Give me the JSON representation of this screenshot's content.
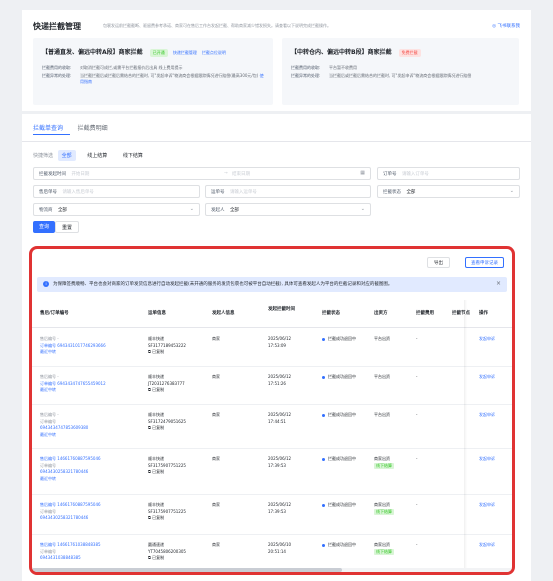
{
  "header": {
    "title": "快递拦截管理",
    "description": "包裹发运前拦截截断、驱留费参考承诺、商家可在售后工作台发起拦截、帮助商家减少错发损失。请查看以下说明完成拦截操作。",
    "help_link": "飞书联系我"
  },
  "rule_boxes": [
    {
      "title": "【普通直发、偏远中转A段】商家拦截",
      "tags": [
        "已开通",
        "快递拦截管理",
        "拦截点位说明"
      ],
      "fee_label": "拦截费用的收取:",
      "fee_text": "对取消拦截可成拦,或需平台拦截报价后出具 线上费用提示",
      "exception_label": "拦截异常的处理:",
      "exception_text": "当拦截拦截后或拦截后需结合的拦截时, 可\"发起申诉\"物流商会根据跟踪情况进行赔偿(最高300元/包)",
      "exception_link": "使用指南"
    },
    {
      "title": "【中转仓内、偏远中转B段】商家拦截",
      "tags": [
        "免费拦截"
      ],
      "fee_label": "拦截费用的收取:",
      "fee_text": "平台暂不收费用",
      "exception_label": "拦截异常的处理:",
      "exception_text": "当拦截后或拦截后需结合的拦截时, 可\"发起申诉\"物流商会根据跟踪情况进行赔偿"
    }
  ],
  "tabs": [
    "拦截单查询",
    "拦截费明细"
  ],
  "quick_filter": {
    "label": "快捷筛选",
    "chips": [
      "全部",
      "线上结算",
      "线下结算"
    ]
  },
  "filters": {
    "intercept_time": {
      "label": "拦截发起时间",
      "start": "开始日期",
      "end": "结束日期"
    },
    "order_no": {
      "label": "订单号",
      "placeholder": "请输入订单号"
    },
    "after_sale_no": {
      "label": "售后单号",
      "placeholder": "请输入售后单号"
    },
    "waybill_no": {
      "label": "运单号",
      "placeholder": "请输入运单号"
    },
    "intercept_status": {
      "label": "拦截状态",
      "value": "全部"
    },
    "logistics": {
      "label": "物流商",
      "value": "全部"
    },
    "initiator": {
      "label": "发起人",
      "value": "全部"
    }
  },
  "buttons": {
    "query": "查询",
    "reset": "重置",
    "export": "导出",
    "appeal_log": "查看申诉记录"
  },
  "notice": "为保障签费顺畅、平台也会对商家的订单发货信息进行自动发起拦截(未开通的服务的发货包裹也可被平台自动拦截), 具体可查看发起人为平台的拦截记录和对应的截图图。",
  "table": {
    "columns": [
      "售后/订单编号",
      "运单信息",
      "发起人信息",
      "发起拦截时间",
      "拦截状态",
      "出资方",
      "拦截费用",
      "拦截节点",
      "操作"
    ],
    "rows": [
      {
        "after_sale": "售后编号 -",
        "order": "订单编号 6943431017746293666",
        "tags": [
          "最近中转"
        ],
        "carrier": "顺丰快递",
        "waybill": "SF3177189453222",
        "copy": "已复制",
        "initiator": "商家",
        "date": "2025/06/12",
        "time": "17:53:09",
        "status": "拦截成功退回中",
        "payer": "平台出资",
        "payer_tag": "",
        "fee": "-",
        "action": "发起申诉"
      },
      {
        "after_sale": "售后编号 -",
        "order": "订单编号 6943434747655459012",
        "tags": [
          "最近中转"
        ],
        "carrier": "顺丰快递",
        "waybill": "JT2031276383777",
        "copy": "已复制",
        "initiator": "商家",
        "date": "2025/06/12",
        "time": "17:51:26",
        "status": "拦截成功退回中",
        "payer": "平台出资",
        "payer_tag": "",
        "fee": "-",
        "action": "发起申诉"
      },
      {
        "after_sale": "售后编号 -",
        "order": "订单编号",
        "order2": "6943434747853609380",
        "tags": [
          "最近中转"
        ],
        "carrier": "顺丰快递",
        "waybill": "SF3172479051625",
        "copy": "已复制",
        "initiator": "商家",
        "date": "2025/06/12",
        "time": "17:44:51",
        "status": "拦截成功退回中",
        "payer": "平台出资",
        "payer_tag": "",
        "fee": "-",
        "action": "发起申诉"
      },
      {
        "after_sale": "售后编号 14661760887595046",
        "order": "订单编号",
        "order2": "6943430258321780446",
        "tags": [
          "最近中转"
        ],
        "carrier": "顺丰快递",
        "waybill": "SF3175907751225",
        "copy": "已复制",
        "initiator": "商家",
        "date": "2025/06/12",
        "time": "17:39:53",
        "status": "拦截成功退回中",
        "payer": "商家出资",
        "payer_tag": "线下结算",
        "fee": "-",
        "action": "发起申诉"
      },
      {
        "after_sale": "售后编号 14661760887595046",
        "order": "订单编号",
        "order2": "6943430258321780446",
        "tags": [],
        "carrier": "顺丰快递",
        "waybill": "SF3175907751225",
        "copy": "已复制",
        "initiator": "商家",
        "date": "2025/06/12",
        "time": "17:39:53",
        "status": "拦截成功退回中",
        "payer": "商家出资",
        "payer_tag": "线下结算",
        "fee": "-",
        "action": "发起申诉"
      },
      {
        "after_sale": "售后编号 14661761038848385",
        "order": "订单编号",
        "order2": "6943431038848385",
        "tags": [],
        "carrier": "圆通速递",
        "waybill": "YT7045806200305",
        "copy": "已复制",
        "initiator": "商家",
        "date": "2025/06/10",
        "time": "20:51:14",
        "status": "拦截成功退回中",
        "payer": "商家出资",
        "payer_tag": "线下结算",
        "fee": "-",
        "action": "发起申诉"
      }
    ]
  },
  "colors": {
    "accent": "#3370ff",
    "highlight_border": "#e03333",
    "success": "#34c724"
  }
}
